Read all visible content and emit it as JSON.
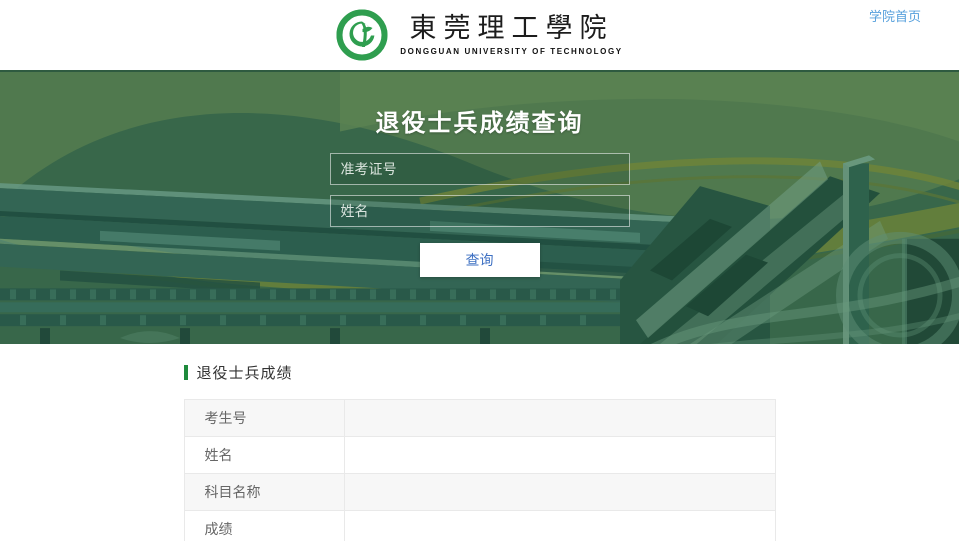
{
  "header": {
    "logo": {
      "emblem_icon": "university-seal-icon",
      "title_zh": "東莞理工學院",
      "subtitle_en": "DONGGUAN UNIVERSITY OF TECHNOLOGY"
    },
    "home_link_label": "学院首页"
  },
  "banner": {
    "title": "退役士兵成绩查询",
    "inputs": [
      {
        "placeholder": "准考证号",
        "value": ""
      },
      {
        "placeholder": "姓名",
        "value": ""
      }
    ],
    "query_button_label": "查询"
  },
  "results": {
    "section_title": "退役士兵成绩",
    "rows": [
      {
        "label": "考生号",
        "value": ""
      },
      {
        "label": "姓名",
        "value": ""
      },
      {
        "label": "科目名称",
        "value": ""
      },
      {
        "label": "成绩",
        "value": ""
      }
    ]
  },
  "colors": {
    "banner_green": "#3c6b4d",
    "accent_green": "#1e8a3c",
    "seal_green": "#2f9e4f",
    "link_blue": "#57a0dc",
    "button_text_blue": "#3c6fc2",
    "table_stripe": "#f7f7f7",
    "table_border": "#e9e9e9"
  }
}
